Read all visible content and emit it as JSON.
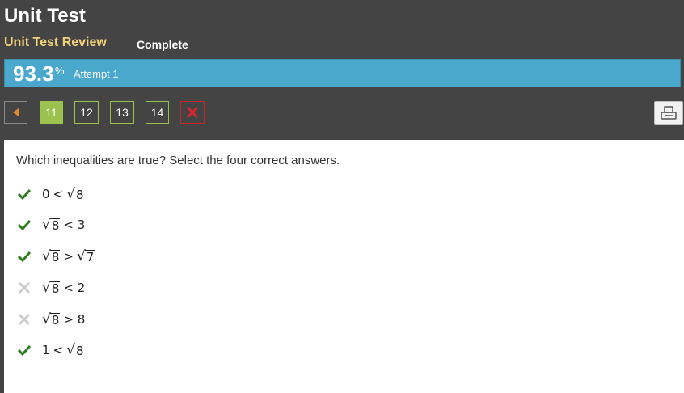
{
  "header": {
    "title": "Unit Test",
    "subtitle": "Unit Test Review",
    "status": "Complete"
  },
  "score": {
    "value": "93.3",
    "unit": "%",
    "attempt": "Attempt 1"
  },
  "nav": {
    "questions": [
      "11",
      "12",
      "13",
      "14"
    ],
    "active": "11"
  },
  "question": {
    "text": "Which inequalities are true? Select the four correct answers."
  },
  "answers": [
    {
      "mark": "check",
      "left": "0",
      "op": "<",
      "right": "√8",
      "parts": [
        "0",
        "<",
        "8"
      ]
    },
    {
      "mark": "check",
      "parts": [
        "8",
        "< 3"
      ]
    },
    {
      "mark": "check",
      "parts": [
        "8",
        ">",
        "7"
      ]
    },
    {
      "mark": "x",
      "parts": [
        "8",
        "< 2"
      ]
    },
    {
      "mark": "x",
      "parts": [
        "8",
        "> 8"
      ]
    },
    {
      "mark": "check",
      "parts": [
        "1",
        "<",
        "8"
      ]
    }
  ],
  "colors": {
    "background": "#444444",
    "score_bar": "#4aa8cc",
    "nav_active": "#9bc14f",
    "check": "#2e7d1e",
    "x_mark": "#cccccc",
    "close": "#c0272d"
  },
  "icons": {
    "prev": "caret-left-icon",
    "close": "x-icon",
    "print": "print-icon",
    "correct": "check-icon",
    "incorrect": "x-icon"
  }
}
